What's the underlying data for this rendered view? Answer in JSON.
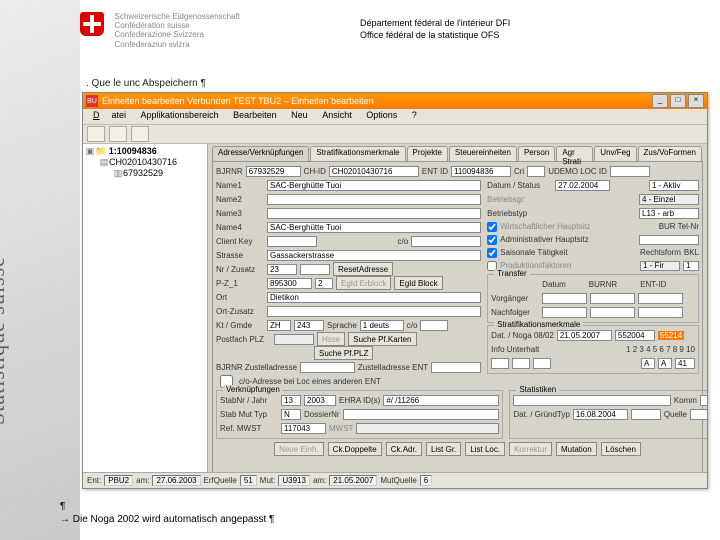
{
  "header": {
    "conf_lines": [
      "Schweizerische Eidgenossenschaft",
      "Confédération suisse",
      "Confederazione Svizzera",
      "Confederaziun svizra"
    ],
    "dept1": "Département fédéral de l'intérieur DFI",
    "dept2": "Office fédéral de la statistique OFS",
    "sidebar_text": "Statistique suisse"
  },
  "caption": ". Que le unc Abspeichern ¶",
  "window": {
    "title": "Einheiten bearbeiten Verbunden TEST TBU2  – Einheiten bearbeiten",
    "menus": [
      "Datei",
      "Applikationsbereich",
      "Bearbeiten",
      "Neu",
      "Ansicht",
      "Options",
      "?"
    ],
    "tree": [
      "1:10094836",
      "CH02010430716",
      "67932529"
    ],
    "tabs": [
      "Adresse/Verknüpfungen",
      "Stratifikationsmerkmale",
      "Projekte",
      "Steuereinheiten",
      "Person",
      "Agr Strati",
      "Unv/Feg",
      "Zus/VoFormen"
    ],
    "ids": {
      "bjrnr_l": "BJRNR",
      "bjrnr": "67932529",
      "chid_l": "CH-ID",
      "chid": "CH02010430716",
      "entid_l": "ENT ID",
      "entid": "110094836",
      "cri_l": "Cri",
      "udemo_l": "UDEMO LOC ID"
    },
    "left": {
      "name1_l": "Name1",
      "name1": "SAC-Berghütte Tuoi",
      "name2_l": "Name2",
      "name3_l": "Name3",
      "name4_l": "Name4",
      "name4": "SAC-Berghütte Tuoi",
      "ck_l": "Client Key",
      "ck": "c/o",
      "strasse_l": "Strasse",
      "strasse": "Gassackerstrasse",
      "nrz_l": "Nr / Zusatz",
      "nr": "23",
      "reset": "ResetAdresse",
      "pz_l": "P-Z_1",
      "pz1": "895300",
      "pz2": "2",
      "egb_l": "EgId Block",
      "ort_l": "Ort",
      "ort": "Dietikon",
      "ortz_l": "Ort-Zusatz",
      "kg_l": "Kt / Gmde",
      "kt": "ZH",
      "gmde": "243",
      "spr_l": "Sprache",
      "spr": "1 deuts",
      "c3": "c/o",
      "pplz_l": "Postfach PLZ",
      "spk": "Suche Pf.Karten",
      "spp": "Suche Pf.PLZ",
      "bza_l": "BJRNR Zustelladresse",
      "zent_l": "Zustelladresse ENT",
      "coa": "c/o-Adresse bei Loc eines anderen ENT"
    },
    "right": {
      "ds_l": "Datum / Status",
      "ds": "27.02.2004",
      "ds2": "1 - Aktiv",
      "bg_l": "Betriebsgr:",
      "bg": "4 - Einzel",
      "bt_l": "Betriebstyp",
      "bt": "L13 - arb",
      "chk1": "Wirtschaftlicher Hauptsitz",
      "chk2": "Administrativer Hauptsitz",
      "chk3": "Saisonale Tätigkeit",
      "chk4": "Produktionsfaktoren",
      "tel_l": "BUR Tel-Nr",
      "rf_l": "Rechtsform",
      "rf": "BKL",
      "pf_l": "1 - Fir",
      "pf_n": "1",
      "tr_l": "Transfer",
      "tr_d": "Datum",
      "tr_b": "BURNR",
      "tr_e": "ENT-ID",
      "vg_l": "Vorgänger",
      "nf_l": "Nachfolger",
      "sm_l": "Stratifikationsmerkmale",
      "dn_l": "Dat. / Noga 08/02",
      "dn_d": "21.05.2007",
      "dn_v": "552004",
      "dn_h": "55214",
      "iu_l": "Info Unterhalt",
      "iu_r": "1 2 3 4 5 6 7 8 9 10",
      "iu_a": "A",
      "iu_b": "A",
      "iu_c": "41"
    },
    "verk": {
      "t": "Verknüpfungen",
      "sj_l": "StabNr / Jahr",
      "sj_a": "13",
      "sj_b": "2003",
      "eh_l": "EHRA ID(s)",
      "eh": "#/ /11266",
      "smt_l": "Stab Mut Typ",
      "smt": "N",
      "dn_l": "DossierNr",
      "ref_l": "Ref. MWST",
      "ref": "117043",
      "mw_l": "MWST",
      "stat_l": "Statistiken",
      "kom_l": "Komm",
      "dg_l": "Dat. / GründTyp",
      "dg": "16.08.2004",
      "q_l": "Quelle"
    },
    "buttons": [
      "Neue Einh.",
      "Ck.Doppelte",
      "Ck.Adr.",
      "List Gr.",
      "List Loc.",
      "Korrektur",
      "Mutation",
      "Löschen"
    ],
    "status": {
      "ent_l": "Ent:",
      "ent": "PBU2",
      "am1_l": "am:",
      "am1": "27.06.2003",
      "eq_l": "ErfQuelle",
      "eq": "51",
      "mut_l": "Mut:",
      "mut": "U3913",
      "am2_l": "am:",
      "am2": "21.05.2007",
      "mq_l": "MutQuelle",
      "mq": "6"
    }
  },
  "bottom": {
    "l1": "¶",
    "l2": "→ Die Noga 2002 wird automatisch angepasst ¶"
  }
}
